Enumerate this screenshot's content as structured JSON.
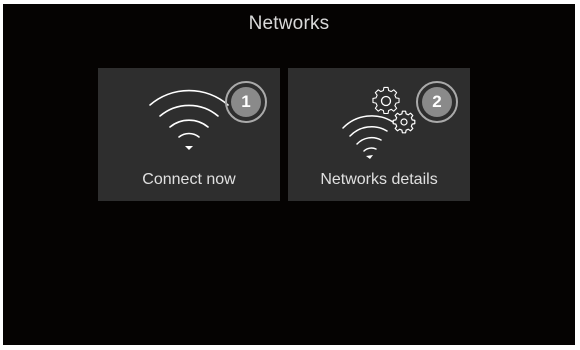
{
  "header": {
    "title": "Networks"
  },
  "tiles": [
    {
      "label": "Connect now",
      "badge": "1",
      "icon": "wifi-icon"
    },
    {
      "label": "Networks details",
      "badge": "2",
      "icon": "wifi-settings-icon"
    }
  ],
  "colors": {
    "screen_background": "#050302",
    "tile_background": "#2e2e2e",
    "badge_fill": "#8a8a8a",
    "badge_ring": "#aaaaaa",
    "icon_color": "#ffffff"
  }
}
